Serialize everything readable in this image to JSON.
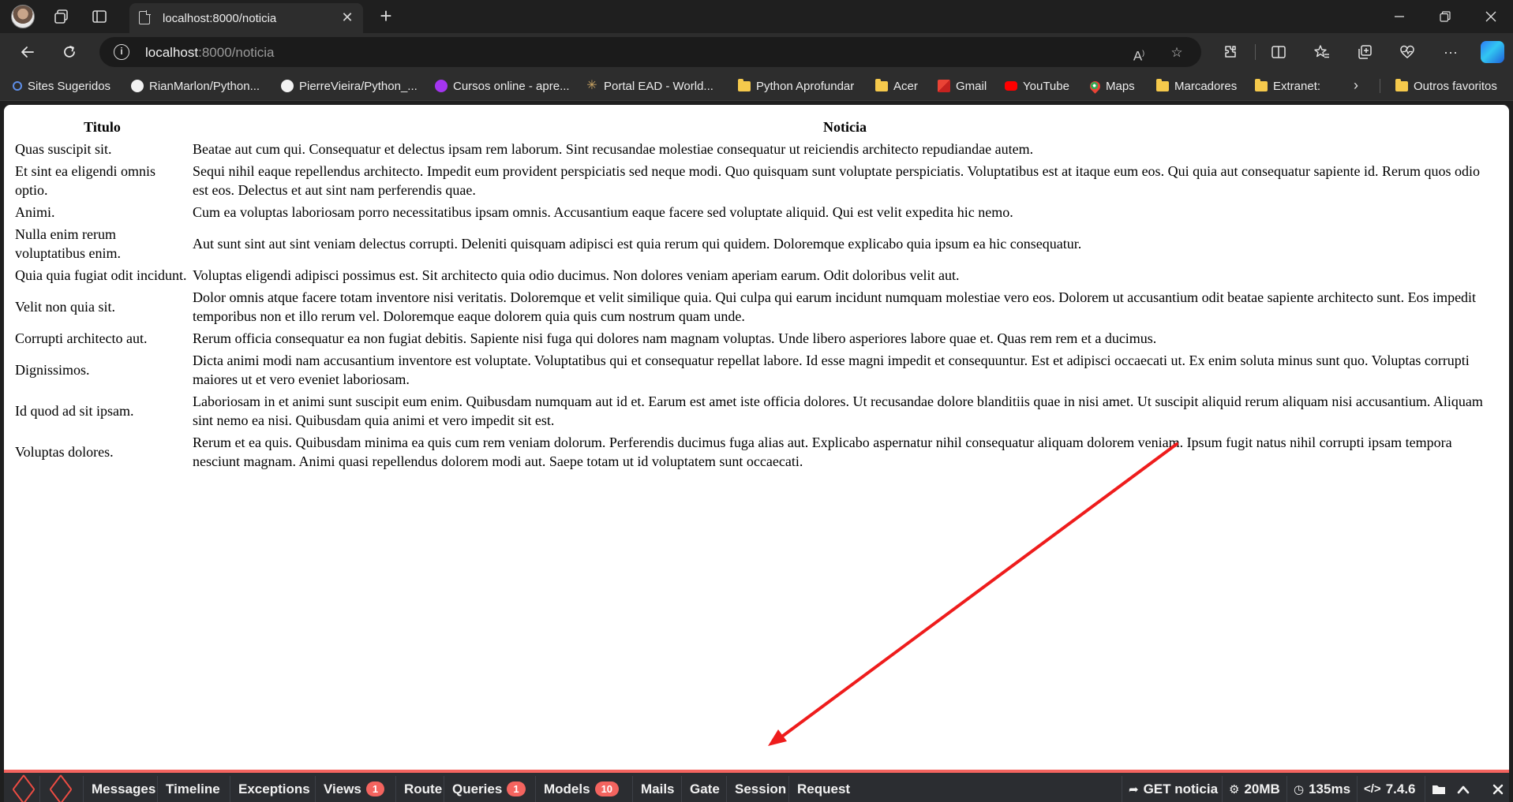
{
  "browser": {
    "tab_title": "localhost:8000/noticia",
    "url_host": "localhost",
    "url_path": ":8000/noticia"
  },
  "bookmarks": [
    {
      "label": "Sites Sugeridos",
      "icon": "search-icon"
    },
    {
      "label": "RianMarlon/Python...",
      "icon": "github-icon"
    },
    {
      "label": "PierreVieira/Python_...",
      "icon": "github-icon"
    },
    {
      "label": "Cursos online - apre...",
      "icon": "udemy-icon"
    },
    {
      "label": "Portal EAD - World...",
      "icon": "portal-icon"
    },
    {
      "label": "Python Aprofundar",
      "icon": "folder-icon"
    },
    {
      "label": "Acer",
      "icon": "folder-icon"
    },
    {
      "label": "Gmail",
      "icon": "gmail-icon"
    },
    {
      "label": "YouTube",
      "icon": "youtube-icon"
    },
    {
      "label": "Maps",
      "icon": "maps-icon"
    },
    {
      "label": "Marcadores",
      "icon": "folder-icon"
    },
    {
      "label": "Extranet:",
      "icon": "folder-icon"
    },
    {
      "label": "Outros favoritos",
      "icon": "folder-icon"
    }
  ],
  "table": {
    "headers": [
      "Titulo",
      "Noticia"
    ],
    "rows": [
      {
        "titulo": "Quas suscipit sit.",
        "noticia": "Beatae aut cum qui. Consequatur et delectus ipsam rem laborum. Sint recusandae molestiae consequatur ut reiciendis architecto repudiandae autem."
      },
      {
        "titulo": "Et sint ea eligendi omnis optio.",
        "noticia": "Sequi nihil eaque repellendus architecto. Impedit eum provident perspiciatis sed neque modi. Quo quisquam sunt voluptate perspiciatis. Voluptatibus est at itaque eum eos. Qui quia aut consequatur sapiente id. Rerum quos odio est eos. Delectus et aut sint nam perferendis quae."
      },
      {
        "titulo": "Animi.",
        "noticia": "Cum ea voluptas laboriosam porro necessitatibus ipsam omnis. Accusantium eaque facere sed voluptate aliquid. Qui est velit expedita hic nemo."
      },
      {
        "titulo": "Nulla enim rerum voluptatibus enim.",
        "noticia": "Aut sunt sint aut sint veniam delectus corrupti. Deleniti quisquam adipisci est quia rerum qui quidem. Doloremque explicabo quia ipsum ea hic consequatur."
      },
      {
        "titulo": "Quia quia fugiat odit incidunt.",
        "noticia": "Voluptas eligendi adipisci possimus est. Sit architecto quia odio ducimus. Non dolores veniam aperiam earum. Odit doloribus velit aut."
      },
      {
        "titulo": "Velit non quia sit.",
        "noticia": "Dolor omnis atque facere totam inventore nisi veritatis. Doloremque et velit similique quia. Qui culpa qui earum incidunt numquam molestiae vero eos. Dolorem ut accusantium odit beatae sapiente architecto sunt. Eos impedit temporibus non et illo rerum vel. Doloremque eaque dolorem quia quis cum nostrum quam unde."
      },
      {
        "titulo": "Corrupti architecto aut.",
        "noticia": "Rerum officia consequatur ea non fugiat debitis. Sapiente nisi fuga qui dolores nam magnam voluptas. Unde libero asperiores labore quae et. Quas rem rem et a ducimus."
      },
      {
        "titulo": "Dignissimos.",
        "noticia": "Dicta animi modi nam accusantium inventore est voluptate. Voluptatibus qui et consequatur repellat labore. Id esse magni impedit et consequuntur. Est et adipisci occaecati ut. Ex enim soluta minus sunt quo. Voluptas corrupti maiores ut et vero eveniet laboriosam."
      },
      {
        "titulo": "Id quod ad sit ipsam.",
        "noticia": "Laboriosam in et animi sunt suscipit eum enim. Quibusdam numquam aut id et. Earum est amet iste officia dolores. Ut recusandae dolore blanditiis quae in nisi amet. Ut suscipit aliquid rerum aliquam nisi accusantium. Aliquam sint nemo ea nisi. Quibusdam quia animi et vero impedit sit est."
      },
      {
        "titulo": "Voluptas dolores.",
        "noticia": "Rerum et ea quis. Quibusdam minima ea quis cum rem veniam dolorum. Perferendis ducimus fuga alias aut. Explicabo aspernatur nihil consequatur aliquam dolorem veniam. Ipsum fugit natus nihil corrupti ipsam tempora nesciunt magnam. Animi quasi repellendus dolorem modi aut. Saepe totam ut id voluptatem sunt occaecati."
      }
    ]
  },
  "debugbar": {
    "tabs": [
      {
        "label": "Messages"
      },
      {
        "label": "Timeline"
      },
      {
        "label": "Exceptions"
      },
      {
        "label": "Views",
        "badge": "1"
      },
      {
        "label": "Route"
      },
      {
        "label": "Queries",
        "badge": "1"
      },
      {
        "label": "Models",
        "badge": "10"
      },
      {
        "label": "Mails"
      },
      {
        "label": "Gate"
      },
      {
        "label": "Session"
      },
      {
        "label": "Request"
      }
    ],
    "route": "GET noticia",
    "memory": "20MB",
    "time": "135ms",
    "php_version": "7.4.6",
    "accent_color": "#f4645f"
  },
  "annotation": {
    "arrow_color": "#ee1c1c"
  }
}
